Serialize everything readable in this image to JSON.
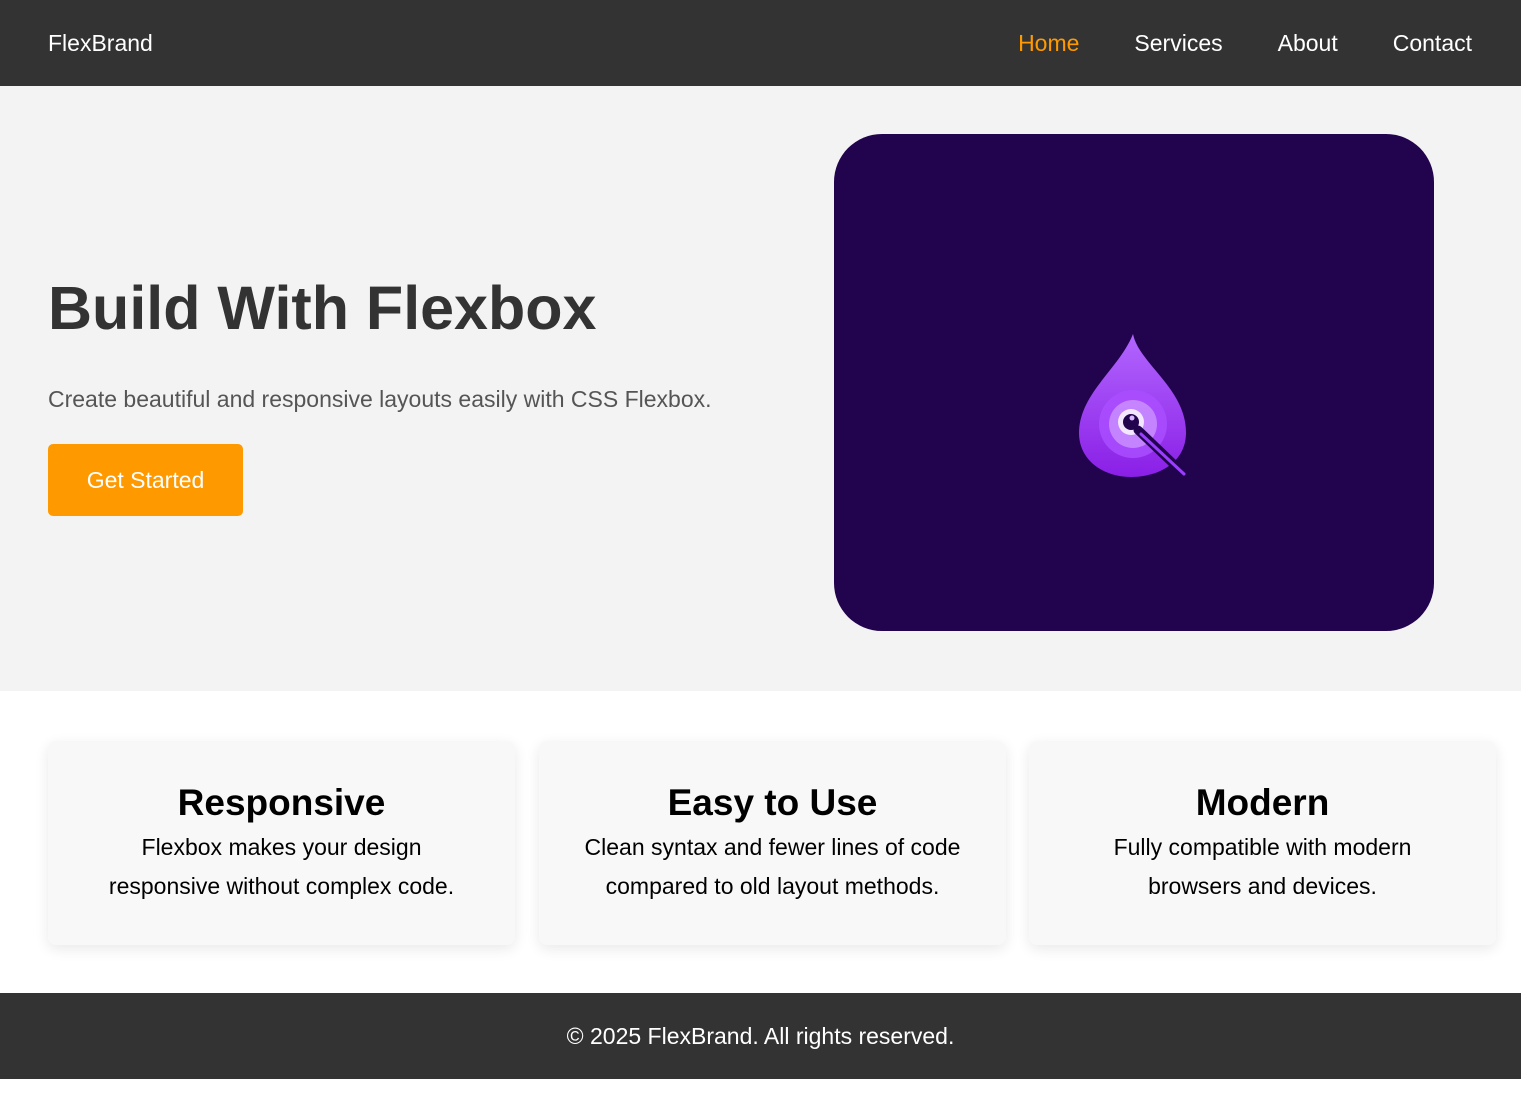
{
  "nav": {
    "brand": "FlexBrand",
    "links": [
      {
        "label": "Home",
        "active": true
      },
      {
        "label": "Services",
        "active": false
      },
      {
        "label": "About",
        "active": false
      },
      {
        "label": "Contact",
        "active": false
      }
    ]
  },
  "hero": {
    "title": "Build With Flexbox",
    "subtitle": "Create beautiful and responsive layouts easily with CSS Flexbox.",
    "cta_label": "Get Started",
    "image_icon": "purple-flame-icon"
  },
  "features": [
    {
      "title": "Responsive",
      "text": "Flexbox makes your design responsive without complex code."
    },
    {
      "title": "Easy to Use",
      "text": "Clean syntax and fewer lines of code compared to old layout methods."
    },
    {
      "title": "Modern",
      "text": "Fully compatible with modern browsers and devices."
    }
  ],
  "footer": {
    "text": "© 2025 FlexBrand. All rights reserved."
  },
  "colors": {
    "nav_bg": "#333333",
    "accent": "#ff9900",
    "hero_bg": "#f3f3f3",
    "image_bg": "#22034d",
    "card_bg": "#f8f8f8"
  }
}
